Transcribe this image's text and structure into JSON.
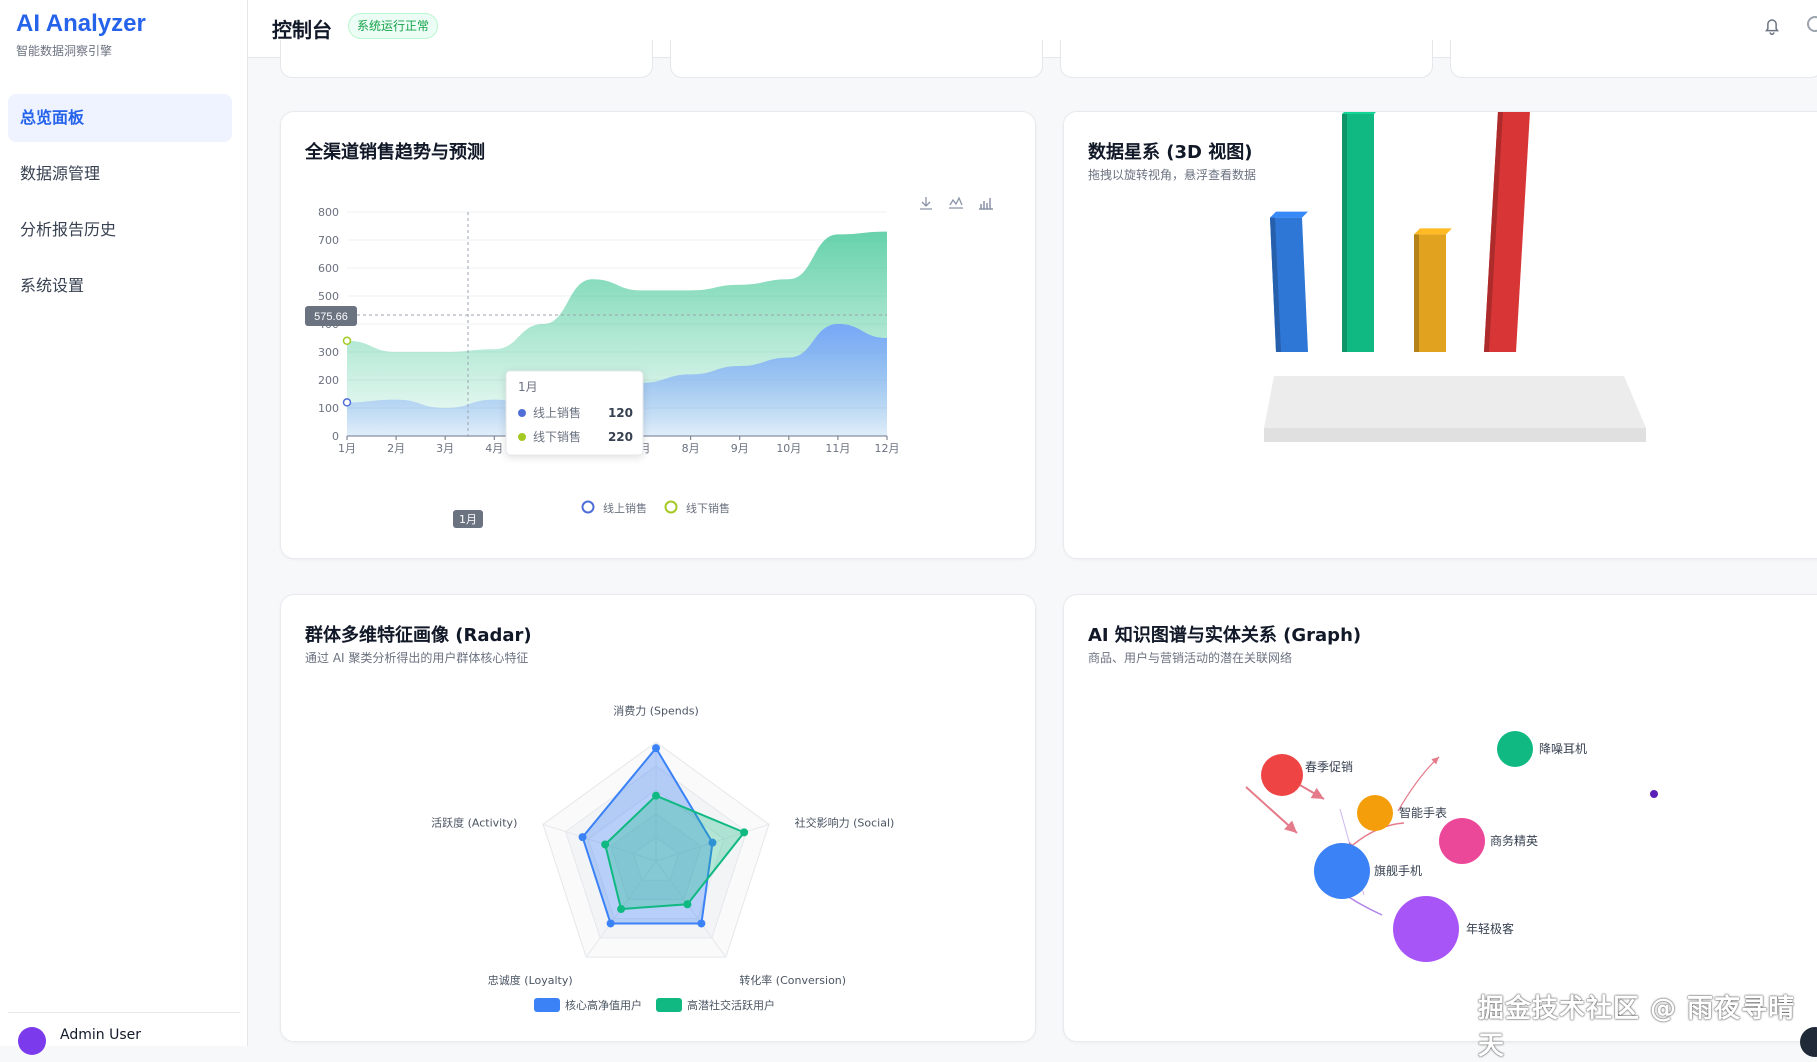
{
  "brand": {
    "name": "AI Analyzer",
    "subtitle": "智能数据洞察引擎"
  },
  "sidebar": {
    "items": [
      {
        "label": "总览面板",
        "active": true
      },
      {
        "label": "数据源管理"
      },
      {
        "label": "分析报告历史"
      },
      {
        "label": "系统设置"
      }
    ],
    "user": {
      "name": "Admin User"
    }
  },
  "header": {
    "title": "控制台",
    "status_badge": "系统运行正常"
  },
  "sales_card": {
    "title": "全渠道销售趋势与预测",
    "toolbox": [
      "download-icon",
      "line-chart-icon",
      "bar-chart-icon"
    ],
    "tooltip": {
      "title": "1月",
      "rows": [
        {
          "name": "线上销售",
          "value": "120"
        },
        {
          "name": "线下销售",
          "value": "220"
        }
      ]
    },
    "crosshair_y_label": "575.66",
    "crosshair_x_label": "1月"
  },
  "galaxy_card": {
    "title": "数据星系 (3D 视图)",
    "subtitle": "拖拽以旋转视角，悬浮查看数据"
  },
  "radar_card": {
    "title": "群体多维特征画像 (Radar)",
    "subtitle": "通过 AI 聚类分析得出的用户群体核心特征"
  },
  "graph_card": {
    "title": "AI 知识图谱与实体关系 (Graph)",
    "subtitle": "商品、用户与营销活动的潜在关联网络"
  },
  "watermark": "掘金技术社区 @ 雨夜寻晴天",
  "colors": {
    "accent": "#2563eb",
    "online": "#5b8ff9",
    "offline": "#34c38f"
  },
  "chart_data": [
    {
      "type": "area",
      "title": "全渠道销售趋势与预测",
      "categories": [
        "1月",
        "2月",
        "3月",
        "4月",
        "5月",
        "6月",
        "7月",
        "8月",
        "9月",
        "10月",
        "11月",
        "12月"
      ],
      "series": [
        {
          "name": "线上销售",
          "values": [
            120,
            130,
            100,
            130,
            100,
            210,
            190,
            220,
            250,
            280,
            400,
            350
          ]
        },
        {
          "name": "线下销售",
          "values": [
            340,
            300,
            300,
            310,
            400,
            560,
            520,
            520,
            540,
            560,
            720,
            730
          ]
        }
      ],
      "ylim": [
        0,
        800
      ],
      "yticks": [
        0,
        100,
        200,
        300,
        400,
        500,
        600,
        700,
        800
      ],
      "legend": "bottom",
      "grid": true
    },
    {
      "type": "bar",
      "title": "数据星系 (3D 视图)",
      "values": [
        0.48,
        0.85,
        0.42,
        0.86
      ],
      "colors": [
        "#2f77d6",
        "#10b981",
        "#e0a21f",
        "#d83636"
      ]
    },
    {
      "type": "radar",
      "title": "群体多维特征画像 (Radar)",
      "indicators": [
        "消费力 (Spends)",
        "社交影响力 (Social)",
        "转化率 (Conversion)",
        "忠诚度 (Loyalty)",
        "活跃度 (Activity)"
      ],
      "series": [
        {
          "name": "核心高净值用户",
          "values": [
            0.95,
            0.5,
            0.65,
            0.65,
            0.65
          ],
          "color": "#3b82f6"
        },
        {
          "name": "高潜社交活跃用户",
          "values": [
            0.55,
            0.78,
            0.45,
            0.5,
            0.45
          ],
          "color": "#10b981"
        }
      ],
      "legend": "bottom"
    },
    {
      "type": "graph",
      "title": "AI 知识图谱与实体关系 (Graph)",
      "nodes": [
        {
          "name": "春季促销",
          "color": "#ef4444"
        },
        {
          "name": "智能手表",
          "color": "#f59e0b"
        },
        {
          "name": "降噪耳机",
          "color": "#10b981"
        },
        {
          "name": "商务精英",
          "color": "#ec4899"
        },
        {
          "name": "旗舰手机",
          "color": "#3b82f6"
        },
        {
          "name": "年轻极客",
          "color": "#a855f7"
        }
      ]
    }
  ]
}
